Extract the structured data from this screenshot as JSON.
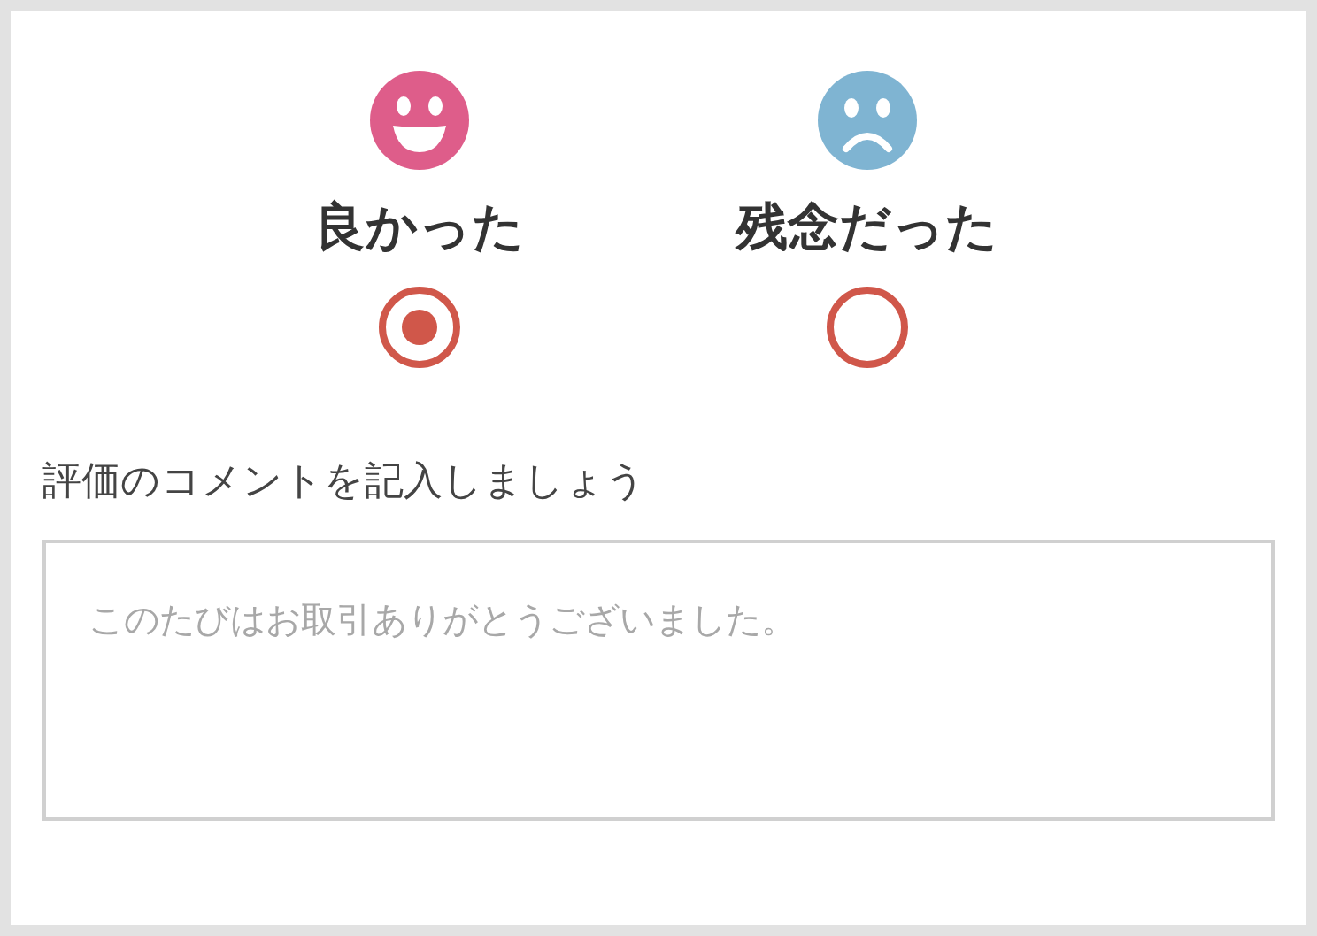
{
  "ratings": [
    {
      "kind": "happy",
      "label": "良かった",
      "color": "#de5d8a",
      "selected": true
    },
    {
      "kind": "sad",
      "label": "残念だった",
      "color": "#7fb4d2",
      "selected": false
    }
  ],
  "comment": {
    "label": "評価のコメントを記入しましょう",
    "placeholder": "このたびはお取引ありがとうございました。"
  }
}
